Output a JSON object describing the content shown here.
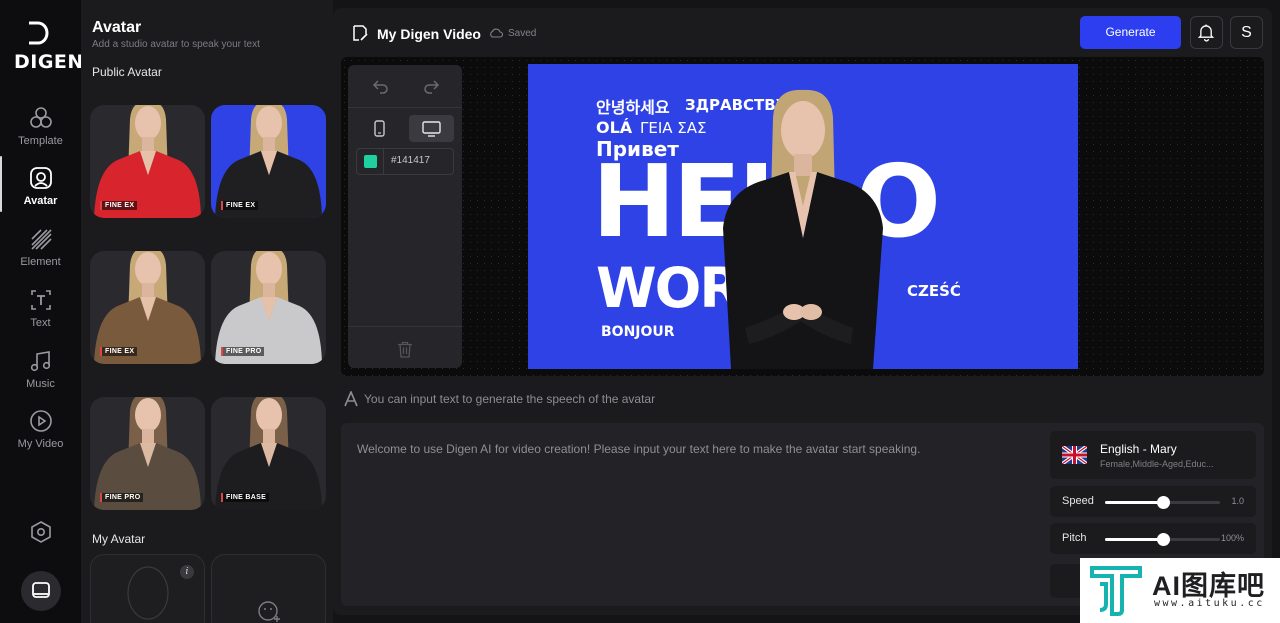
{
  "brand": {
    "name": "DIGEN"
  },
  "nav": {
    "items": [
      {
        "label": "Template",
        "icon": "template-icon"
      },
      {
        "label": "Avatar",
        "icon": "avatar-icon"
      },
      {
        "label": "Element",
        "icon": "element-icon"
      },
      {
        "label": "Text",
        "icon": "text-icon"
      },
      {
        "label": "Music",
        "icon": "music-icon"
      },
      {
        "label": "My Video",
        "icon": "my-video-icon"
      }
    ],
    "active": "Avatar"
  },
  "panel": {
    "title": "Avatar",
    "subtitle": "Add a studio avatar to speak your text",
    "public_title": "Public Avatar",
    "public_avatars": [
      {
        "tag": "FINE EX",
        "outfit": "#d8242c",
        "bg": "#2a2a2e"
      },
      {
        "tag": "FINE EX",
        "outfit": "#1f1f22",
        "bg": "#2f42e6"
      },
      {
        "tag": "FINE EX",
        "outfit": "#7a5a3c",
        "bg": "#2a2a2e"
      },
      {
        "tag": "FINE PRO",
        "outfit": "#c9c9cb",
        "bg": "#2a2a2e"
      },
      {
        "tag": "FINE PRO",
        "outfit": "#5a4d3f",
        "bg": "#2a2a2e"
      },
      {
        "tag": "FINE BASE",
        "outfit": "#1d1d1f",
        "bg": "#2a2a2e"
      }
    ],
    "my_title": "My Avatar",
    "info_badge": "i"
  },
  "header": {
    "title": "My Digen Video",
    "saved": "Saved",
    "generate": "Generate",
    "user_initial": "S"
  },
  "tools": {
    "color_value": "#141417",
    "swatch_color": "#1fd1a0"
  },
  "canvas": {
    "bg_color": "#2f42e6",
    "words": {
      "korean": "안녕하세요",
      "russian": "ЗДРАВСТВУЙ",
      "portuguese": "OLÁ",
      "greek": "ΓΕΙΑ ΣΑΣ",
      "privet": "Привет",
      "hello": "HELLO",
      "world": "WORLD",
      "czesc": "CZEŚĆ",
      "bonjour": "BONJOUR"
    }
  },
  "hint": "You can input text to generate the speech of the avatar",
  "speech_text": "Welcome to use Digen AI for video creation! Please input your text here to make the avatar start speaking.",
  "voice": {
    "name": "English - Mary",
    "desc": "Female,Middle-Aged,Educ..."
  },
  "speed": {
    "label": "Speed",
    "value_text": "1.0",
    "fraction": 0.5
  },
  "pitch": {
    "label": "Pitch",
    "value_text": "100%",
    "fraction": 0.5
  },
  "watermark": {
    "text": "AI图库吧",
    "url": "www.aituku.cc"
  }
}
